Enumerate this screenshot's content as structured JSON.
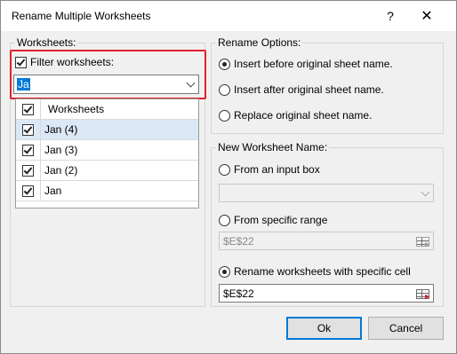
{
  "window": {
    "title": "Rename Multiple Worksheets",
    "help_label": "?",
    "close_label": "✕"
  },
  "worksheets": {
    "group_label": "Worksheets:",
    "filter": {
      "label": "Filter worksheets:",
      "checked": true,
      "value": "Ja",
      "highlight_color": "#e0202a"
    },
    "list": {
      "header": "Worksheets",
      "items": [
        {
          "label": "Jan (4)",
          "checked": true,
          "selected": true
        },
        {
          "label": "Jan (3)",
          "checked": true,
          "selected": false
        },
        {
          "label": "Jan (2)",
          "checked": true,
          "selected": false
        },
        {
          "label": "Jan",
          "checked": true,
          "selected": false
        }
      ]
    }
  },
  "rename_options": {
    "group_label": "Rename Options:",
    "options": [
      {
        "label": "Insert before original sheet name.",
        "selected": true
      },
      {
        "label": "Insert after original sheet name.",
        "selected": false
      },
      {
        "label": "Replace original sheet name.",
        "selected": false
      }
    ]
  },
  "new_name": {
    "group_label": "New Worksheet Name:",
    "from_input_box": {
      "label": "From an input box",
      "selected": false,
      "value": ""
    },
    "from_range": {
      "label": "From specific range",
      "selected": false,
      "value": "$E$22"
    },
    "specific_cell": {
      "label": "Rename worksheets with specific cell",
      "selected": true,
      "value": "$E$22"
    }
  },
  "buttons": {
    "ok": "Ok",
    "cancel": "Cancel"
  },
  "colors": {
    "selection_blue": "#0078d7",
    "row_highlight": "#dce8f5"
  }
}
